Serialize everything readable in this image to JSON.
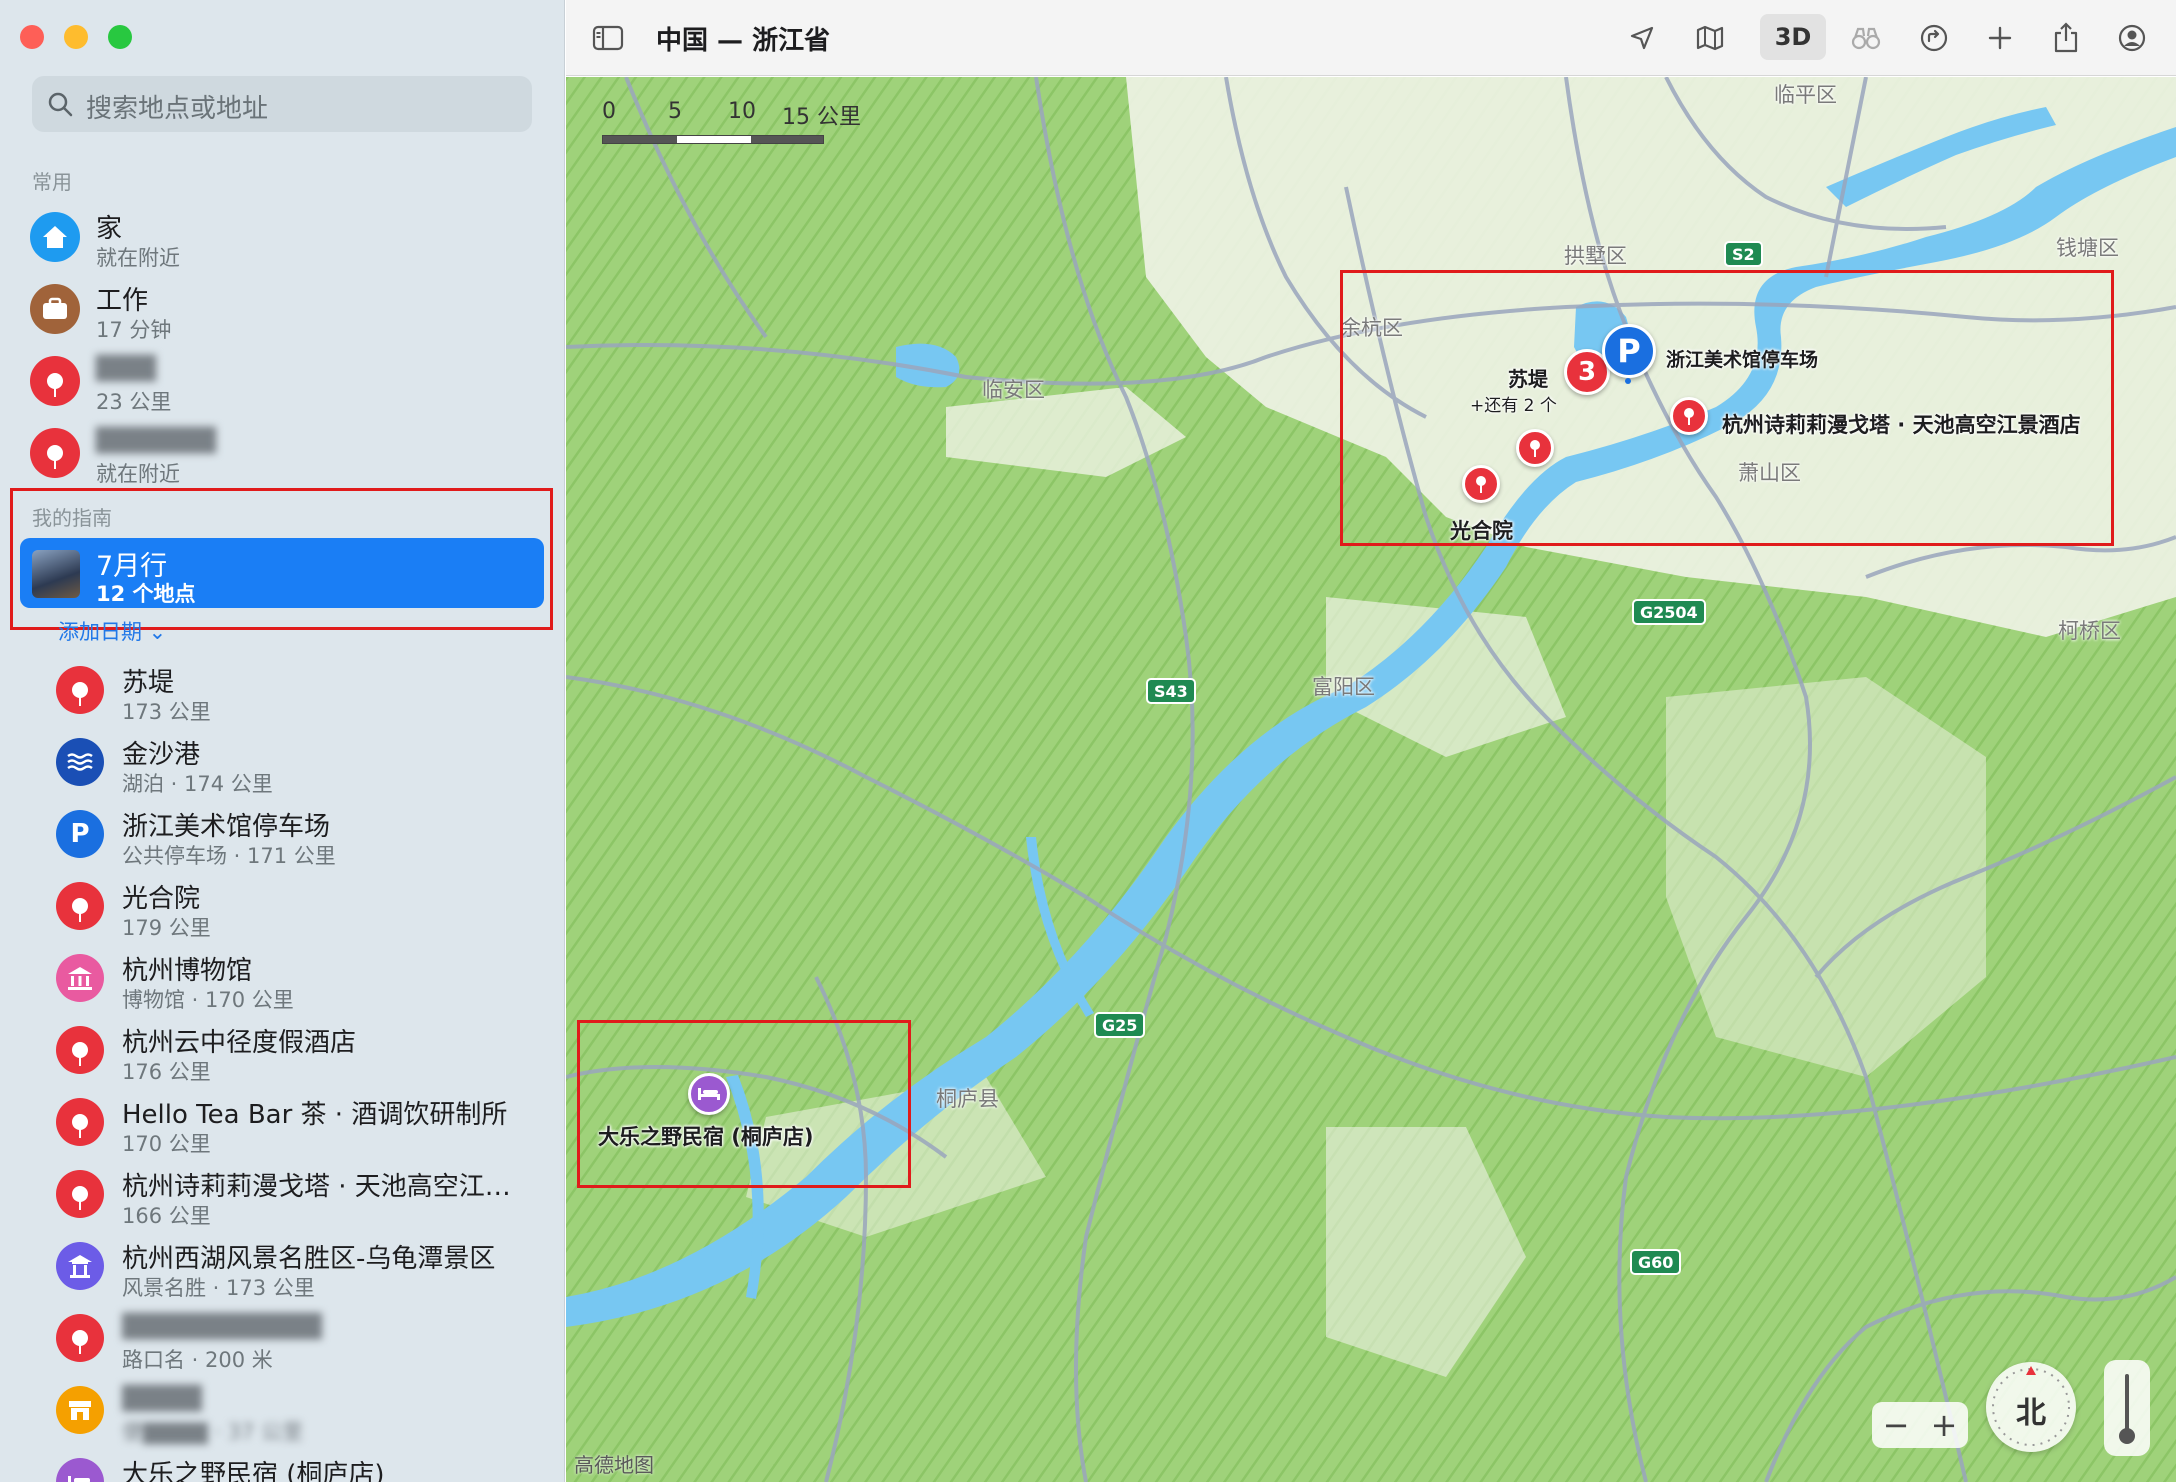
{
  "window": {
    "title": "中国 — 浙江省"
  },
  "search": {
    "placeholder": "搜索地点或地址"
  },
  "favorites": {
    "header": "常用",
    "items": [
      {
        "title": "家",
        "subtitle": "就在附近",
        "icon": "house-icon",
        "color": "#1e9bf0"
      },
      {
        "title": "工作",
        "subtitle": "17 分钟",
        "icon": "briefcase-icon",
        "color": "#a0633a"
      },
      {
        "title": "▇▇▇",
        "subtitle": "23 公里",
        "icon": "pin-icon",
        "color": "#e8323c",
        "blurred": true
      },
      {
        "title": "▇▇▇▇▇▇",
        "subtitle": "就在附近",
        "icon": "pin-icon",
        "color": "#e8323c",
        "blurred": true
      }
    ]
  },
  "guides": {
    "header": "我的指南",
    "selected": {
      "title": "7月行",
      "subtitle": "12 个地点"
    },
    "add_date": "添加日期 ⌄",
    "items": [
      {
        "title": "苏堤",
        "subtitle": "173 公里",
        "icon": "pin-icon",
        "color": "#e8323c"
      },
      {
        "title": "金沙港",
        "subtitle": "湖泊 · 174 公里",
        "icon": "lake-icon",
        "color": "#1a4fb5"
      },
      {
        "title": "浙江美术馆停车场",
        "subtitle": "公共停车场 · 171 公里",
        "icon": "parking-icon",
        "color": "#1a6fe0"
      },
      {
        "title": "光合院",
        "subtitle": "179 公里",
        "icon": "pin-icon",
        "color": "#e8323c"
      },
      {
        "title": "杭州博物馆",
        "subtitle": "博物馆 · 170 公里",
        "icon": "museum-icon",
        "color": "#e95aa0"
      },
      {
        "title": "杭州云中径度假酒店",
        "subtitle": "176 公里",
        "icon": "pin-icon",
        "color": "#e8323c"
      },
      {
        "title": "Hello Tea Bar 茶 · 酒调饮研制所",
        "subtitle": "170 公里",
        "icon": "pin-icon",
        "color": "#e8323c"
      },
      {
        "title": "杭州诗莉莉漫戈塔 · 天池高空江…",
        "subtitle": "166 公里",
        "icon": "pin-icon",
        "color": "#e8323c"
      },
      {
        "title": "杭州西湖风景名胜区-乌龟潭景区",
        "subtitle": "风景名胜 · 173 公里",
        "icon": "pavilion-icon",
        "color": "#6c5ce7"
      },
      {
        "title": "▇▇▇▇▇▇▇▇▇▇",
        "subtitle": "路口名 · 200 米",
        "icon": "pin-icon",
        "color": "#e8323c",
        "blurred": true
      },
      {
        "title": "▇▇▇▇",
        "subtitle": "便▇▇▇▇ · 37 公里",
        "icon": "store-icon",
        "color": "#f5a000",
        "blurred": true
      },
      {
        "title": "大乐之野民宿 (桐庐店)",
        "subtitle": "",
        "icon": "bed-icon",
        "color": "#9b59d0"
      }
    ]
  },
  "toolbar": {
    "three_d": "3D"
  },
  "map": {
    "scale": {
      "labels": [
        "0",
        "5",
        "10",
        "15 公里"
      ]
    },
    "districts": [
      "临平区",
      "拱墅区",
      "钱塘区",
      "余杭区",
      "临安区",
      "萧山区",
      "柯桥区",
      "富阳区",
      "桐庐县"
    ],
    "shields": [
      "S2",
      "G2504",
      "S43",
      "G25",
      "G60"
    ],
    "places": {
      "sudi": "苏堤",
      "sudi_more": "+还有 2 个",
      "cluster_count": "3",
      "parking": "浙江美术馆停车场",
      "parking_letter": "P",
      "hotel": "杭州诗莉莉漫戈塔 · 天池高空江景酒店",
      "guanghe": "光合院",
      "minsu": "大乐之野民宿 (桐庐店)"
    },
    "compass_label": "北",
    "zoom_minus": "−",
    "zoom_plus": "+",
    "attribution": "高德地图"
  }
}
